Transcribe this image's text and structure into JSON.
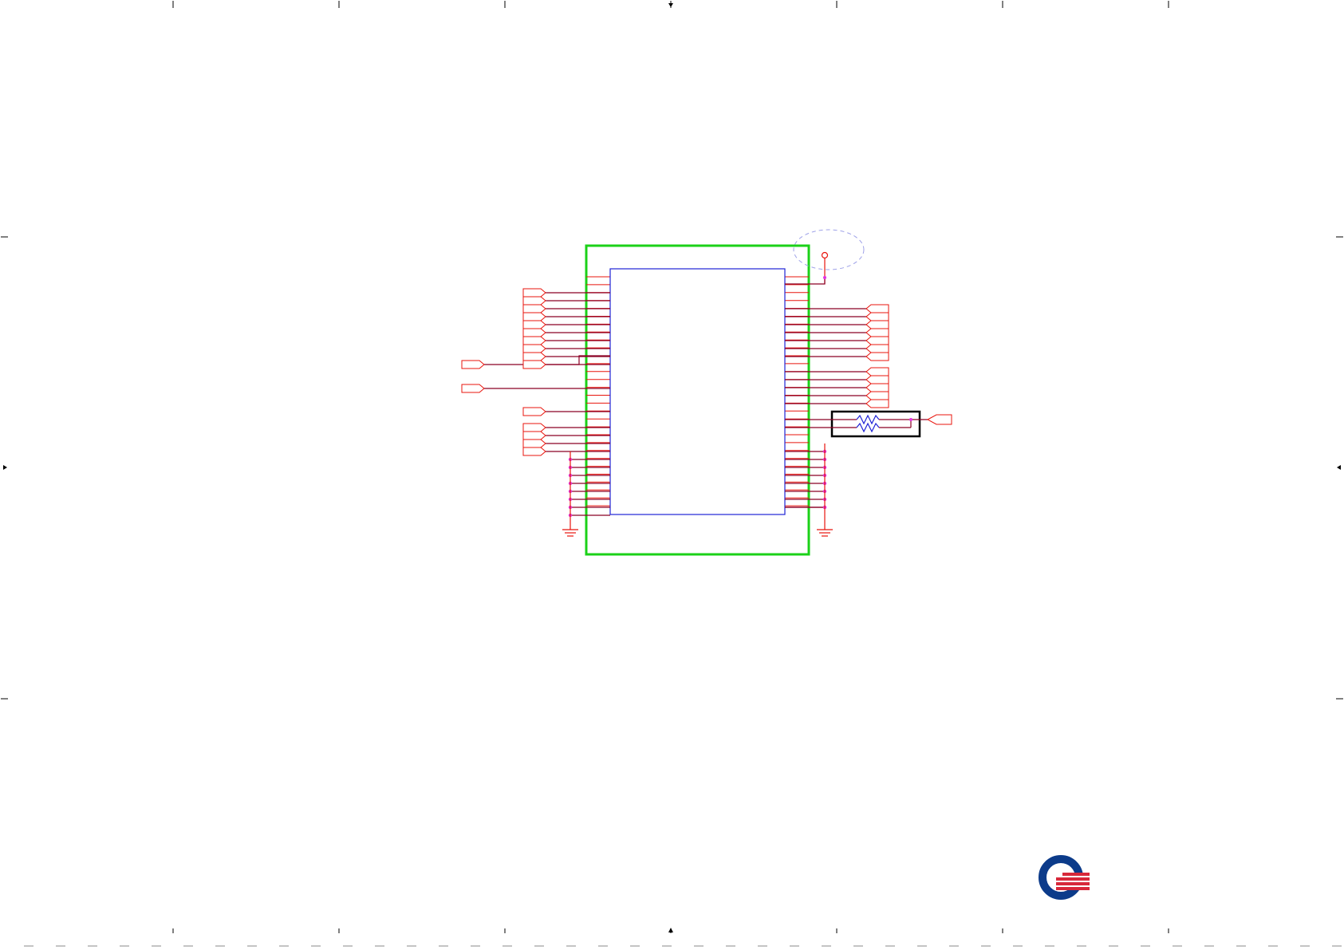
{
  "colors": {
    "frame": "#000000",
    "wire": "#8b0025",
    "port": "#e8140c",
    "outline": "#1bd118",
    "ic_body": "#1f23d6",
    "junction": "#e233e0",
    "resistor": "#1f23d6",
    "callout": "#9fa2e8",
    "logo_blue": "#0c3b8a",
    "logo_red": "#d7283a"
  },
  "icons": {
    "logo": "company-logo-icon",
    "ground": "ground-icon",
    "resistor": "resistor-icon",
    "test_point": "test-point-icon"
  },
  "schematic": {
    "left_ports_group_a": 10,
    "left_ports_group_b": 4,
    "right_ports_group_a": 7,
    "right_ports_group_b": 5,
    "ic_pins_per_side": 30,
    "ground_junctions_per_side": 8,
    "resistor_count": 2
  }
}
